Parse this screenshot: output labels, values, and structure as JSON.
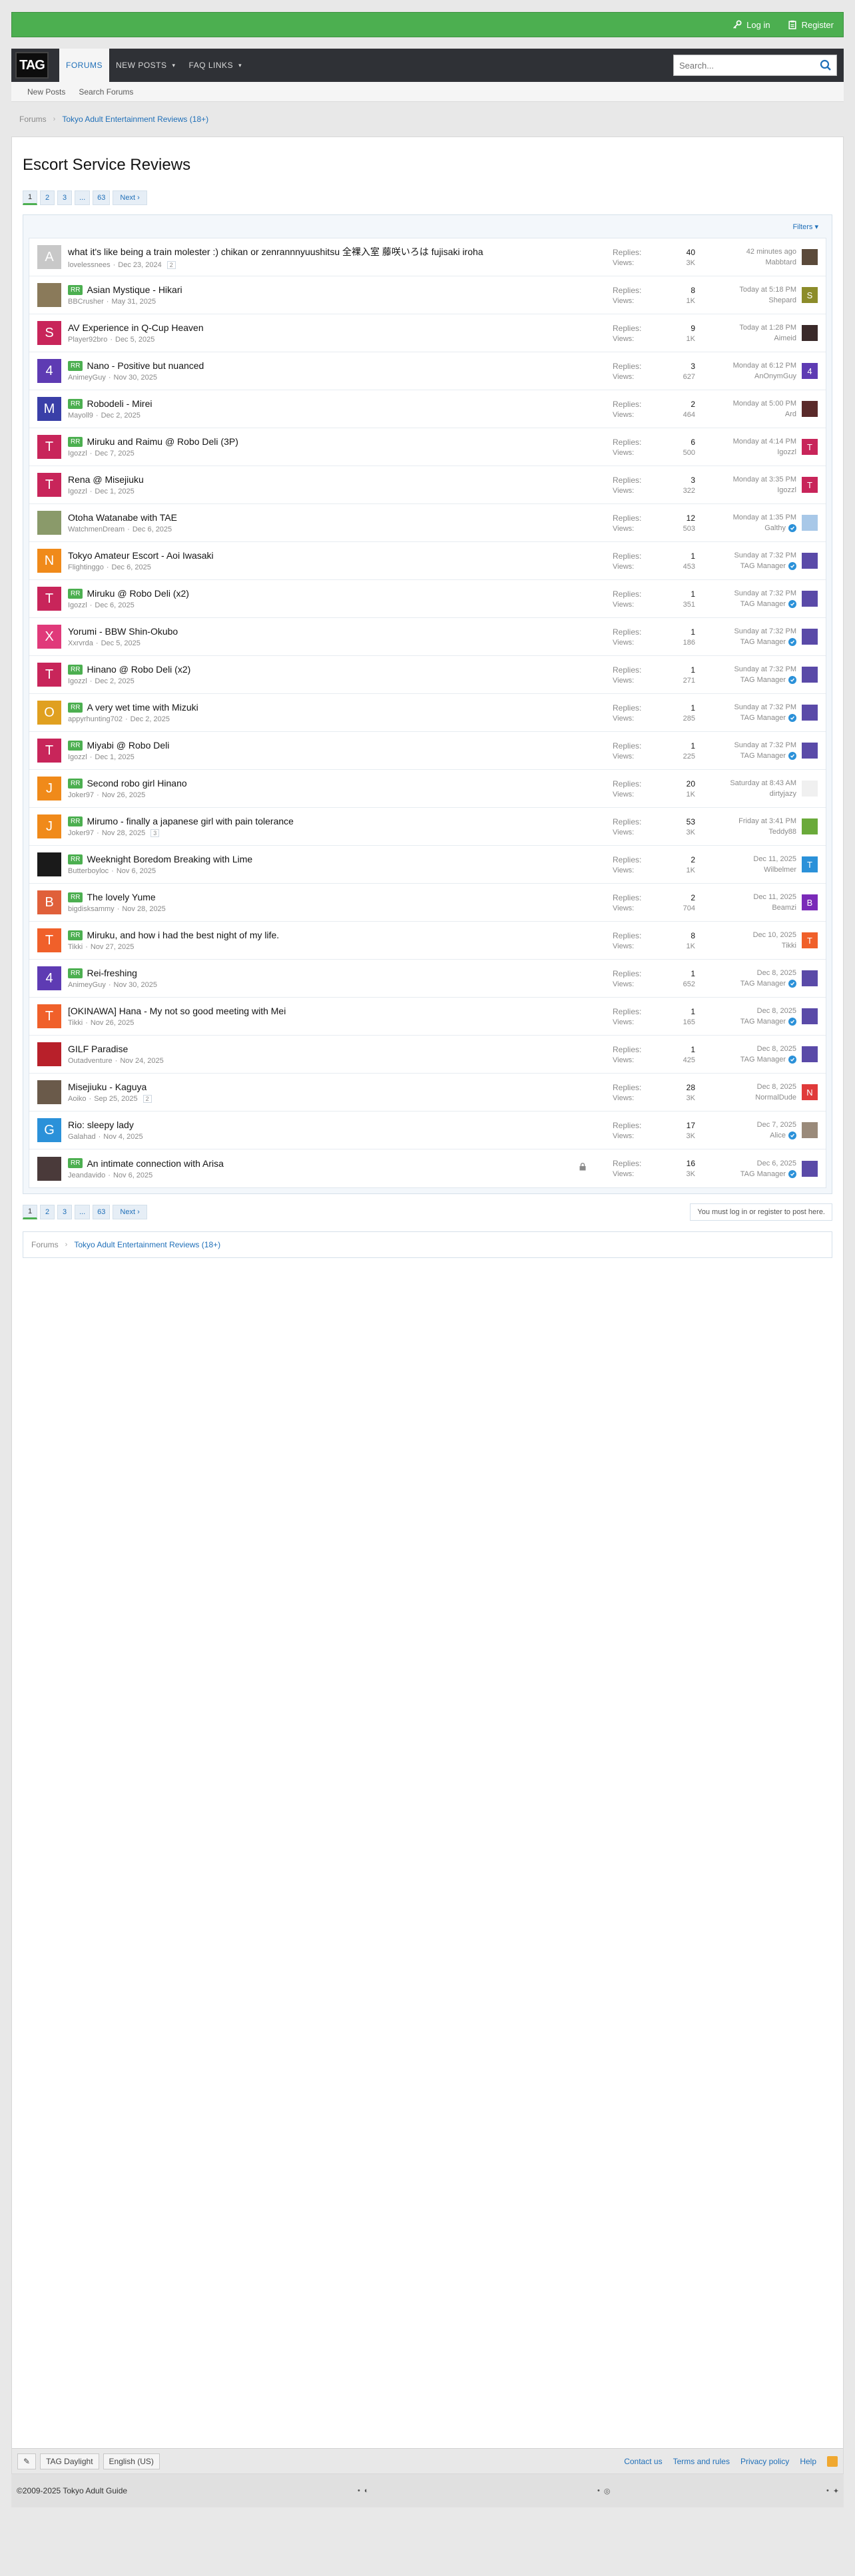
{
  "topbar": {
    "login": "Log in",
    "register": "Register"
  },
  "nav": {
    "logo": "TAG",
    "tabs": [
      {
        "label": "FORUMS",
        "active": true,
        "dropdown": false
      },
      {
        "label": "NEW POSTS",
        "active": false,
        "dropdown": true
      },
      {
        "label": "FAQ LINKS",
        "active": false,
        "dropdown": true
      }
    ],
    "search_placeholder": "Search..."
  },
  "subnav": [
    "New Posts",
    "Search Forums"
  ],
  "breadcrumb": {
    "root": "Forums",
    "current": "Tokyo Adult Entertainment Reviews (18+)"
  },
  "page": {
    "title": "Escort Service Reviews"
  },
  "pager": {
    "pages": [
      "1",
      "2",
      "3",
      "...",
      "63"
    ],
    "next": "Next"
  },
  "filters": "Filters",
  "labels": {
    "replies": "Replies:",
    "views": "Views:"
  },
  "threads": [
    {
      "title": "what it's like being a train molester :) chikan or zenrannnyuushitsu 全裸入室 藤咲いろは fujisaki iroha",
      "prefix": "",
      "author": "lovelessnees",
      "date": "Dec 23, 2024",
      "pages": "2",
      "replies": "40",
      "views": "3K",
      "last_time": "42 minutes ago",
      "last_user": "Mabbtard",
      "av": "A",
      "av_color": "#c8c8c8",
      "sav": "",
      "sav_color": "#5b4a3a",
      "verified": false,
      "locked": false
    },
    {
      "title": "Asian Mystique - Hikari",
      "prefix": "RR",
      "author": "BBCrusher",
      "date": "May 31, 2025",
      "pages": "",
      "replies": "8",
      "views": "1K",
      "last_time": "Today at 5:18 PM",
      "last_user": "Shepard",
      "av": "",
      "av_color": "#8a7a5a",
      "sav": "S",
      "sav_color": "#8c8c2a",
      "verified": false,
      "locked": false
    },
    {
      "title": "AV Experience in Q-Cup Heaven",
      "prefix": "",
      "author": "Player92bro",
      "date": "Dec 5, 2025",
      "pages": "",
      "replies": "9",
      "views": "1K",
      "last_time": "Today at 1:28 PM",
      "last_user": "Aimeid",
      "av": "S",
      "av_color": "#c8255a",
      "sav": "",
      "sav_color": "#3a2a2a",
      "verified": false,
      "locked": false
    },
    {
      "title": "Nano - Positive but nuanced",
      "prefix": "RR",
      "author": "AnimeyGuy",
      "date": "Nov 30, 2025",
      "pages": "",
      "replies": "3",
      "views": "627",
      "last_time": "Monday at 6:12 PM",
      "last_user": "AnOnymGuy",
      "av": "4",
      "av_color": "#5e3bb3",
      "sav": "4",
      "sav_color": "#5e3bb3",
      "verified": false,
      "locked": false
    },
    {
      "title": "Robodeli - Mirei",
      "prefix": "RR",
      "author": "Mayoll9",
      "date": "Dec 2, 2025",
      "pages": "",
      "replies": "2",
      "views": "464",
      "last_time": "Monday at 5:00 PM",
      "last_user": "Ard",
      "av": "M",
      "av_color": "#3a3fa8",
      "sav": "",
      "sav_color": "#5a2a2a",
      "verified": false,
      "locked": false
    },
    {
      "title": "Miruku and Raimu @ Robo Deli (3P)",
      "prefix": "RR",
      "author": "Igozzl",
      "date": "Dec 7, 2025",
      "pages": "",
      "replies": "6",
      "views": "500",
      "last_time": "Monday at 4:14 PM",
      "last_user": "Igozzl",
      "av": "T",
      "av_color": "#c8255a",
      "sav": "T",
      "sav_color": "#c8255a",
      "verified": false,
      "locked": false
    },
    {
      "title": "Rena @ Misejiuku",
      "prefix": "",
      "author": "Igozzl",
      "date": "Dec 1, 2025",
      "pages": "",
      "replies": "3",
      "views": "322",
      "last_time": "Monday at 3:35 PM",
      "last_user": "Igozzl",
      "av": "T",
      "av_color": "#c8255a",
      "sav": "T",
      "sav_color": "#c8255a",
      "verified": false,
      "locked": false
    },
    {
      "title": "Otoha Watanabe with TAE",
      "prefix": "",
      "author": "WatchmenDream",
      "date": "Dec 6, 2025",
      "pages": "",
      "replies": "12",
      "views": "503",
      "last_time": "Monday at 1:35 PM",
      "last_user": "Galthy",
      "av": "",
      "av_color": "#8a9a6a",
      "sav": "",
      "sav_color": "#a8c8e8",
      "verified": true,
      "locked": false
    },
    {
      "title": "Tokyo Amateur Escort - Aoi Iwasaki",
      "prefix": "",
      "author": "Flightinggo",
      "date": "Dec 6, 2025",
      "pages": "",
      "replies": "1",
      "views": "453",
      "last_time": "Sunday at 7:32 PM",
      "last_user": "TAG Manager",
      "av": "N",
      "av_color": "#f08a1a",
      "sav": "",
      "sav_color": "#5a4aa8",
      "verified": true,
      "locked": false
    },
    {
      "title": "Miruku @ Robo Deli (x2)",
      "prefix": "RR",
      "author": "Igozzl",
      "date": "Dec 6, 2025",
      "pages": "",
      "replies": "1",
      "views": "351",
      "last_time": "Sunday at 7:32 PM",
      "last_user": "TAG Manager",
      "av": "T",
      "av_color": "#c8255a",
      "sav": "",
      "sav_color": "#5a4aa8",
      "verified": true,
      "locked": false
    },
    {
      "title": "Yorumi - BBW Shin-Okubo",
      "prefix": "",
      "author": "Xxrvrda",
      "date": "Dec 5, 2025",
      "pages": "",
      "replies": "1",
      "views": "186",
      "last_time": "Sunday at 7:32 PM",
      "last_user": "TAG Manager",
      "av": "X",
      "av_color": "#e03a7a",
      "sav": "",
      "sav_color": "#5a4aa8",
      "verified": true,
      "locked": false
    },
    {
      "title": "Hinano @ Robo Deli (x2)",
      "prefix": "RR",
      "author": "Igozzl",
      "date": "Dec 2, 2025",
      "pages": "",
      "replies": "1",
      "views": "271",
      "last_time": "Sunday at 7:32 PM",
      "last_user": "TAG Manager",
      "av": "T",
      "av_color": "#c8255a",
      "sav": "",
      "sav_color": "#5a4aa8",
      "verified": true,
      "locked": false
    },
    {
      "title": "A very wet time with Mizuki",
      "prefix": "RR",
      "author": "appyrhunting702",
      "date": "Dec 2, 2025",
      "pages": "",
      "replies": "1",
      "views": "285",
      "last_time": "Sunday at 7:32 PM",
      "last_user": "TAG Manager",
      "av": "O",
      "av_color": "#e0a020",
      "sav": "",
      "sav_color": "#5a4aa8",
      "verified": true,
      "locked": false
    },
    {
      "title": "Miyabi @ Robo Deli",
      "prefix": "RR",
      "author": "Igozzl",
      "date": "Dec 1, 2025",
      "pages": "",
      "replies": "1",
      "views": "225",
      "last_time": "Sunday at 7:32 PM",
      "last_user": "TAG Manager",
      "av": "T",
      "av_color": "#c8255a",
      "sav": "",
      "sav_color": "#5a4aa8",
      "verified": true,
      "locked": false
    },
    {
      "title": "Second robo girl Hinano",
      "prefix": "RR",
      "author": "Joker97",
      "date": "Nov 26, 2025",
      "pages": "",
      "replies": "20",
      "views": "1K",
      "last_time": "Saturday at 8:43 AM",
      "last_user": "dirtyjazy",
      "av": "J",
      "av_color": "#f08a1a",
      "sav": "",
      "sav_color": "#f0f0f0",
      "verified": false,
      "locked": false
    },
    {
      "title": "Mirumo - finally a japanese girl with pain tolerance",
      "prefix": "RR",
      "author": "Joker97",
      "date": "Nov 28, 2025",
      "pages": "3",
      "replies": "53",
      "views": "3K",
      "last_time": "Friday at 3:41 PM",
      "last_user": "Teddy88",
      "av": "J",
      "av_color": "#f08a1a",
      "sav": "",
      "sav_color": "#6aaa3a",
      "verified": false,
      "locked": false
    },
    {
      "title": "Weeknight Boredom Breaking with Lime",
      "prefix": "RR",
      "author": "Butterboyloc",
      "date": "Nov 6, 2025",
      "pages": "",
      "replies": "2",
      "views": "1K",
      "last_time": "Dec 11, 2025",
      "last_user": "Wilbelmer",
      "av": "",
      "av_color": "#1a1a1a",
      "sav": "T",
      "sav_color": "#2b91d9",
      "verified": false,
      "locked": false
    },
    {
      "title": "The lovely Yume",
      "prefix": "RR",
      "author": "bigdisksammy",
      "date": "Nov 28, 2025",
      "pages": "",
      "replies": "2",
      "views": "704",
      "last_time": "Dec 11, 2025",
      "last_user": "Beamzi",
      "av": "B",
      "av_color": "#e0603a",
      "sav": "B",
      "sav_color": "#7a2ab8",
      "verified": false,
      "locked": false
    },
    {
      "title": "Miruku, and how i had the best night of my life.",
      "prefix": "RR",
      "author": "Tikki",
      "date": "Nov 27, 2025",
      "pages": "",
      "replies": "8",
      "views": "1K",
      "last_time": "Dec 10, 2025",
      "last_user": "Tikki",
      "av": "T",
      "av_color": "#f0602a",
      "sav": "T",
      "sav_color": "#f0602a",
      "verified": false,
      "locked": false
    },
    {
      "title": "Rei-freshing",
      "prefix": "RR",
      "author": "AnimeyGuy",
      "date": "Nov 30, 2025",
      "pages": "",
      "replies": "1",
      "views": "652",
      "last_time": "Dec 8, 2025",
      "last_user": "TAG Manager",
      "av": "4",
      "av_color": "#5e3bb3",
      "sav": "",
      "sav_color": "#5a4aa8",
      "verified": true,
      "locked": false
    },
    {
      "title": "[OKINAWA] Hana - My not so good meeting with Mei",
      "prefix": "",
      "author": "Tikki",
      "date": "Nov 26, 2025",
      "pages": "",
      "replies": "1",
      "views": "165",
      "last_time": "Dec 8, 2025",
      "last_user": "TAG Manager",
      "av": "T",
      "av_color": "#f0602a",
      "sav": "",
      "sav_color": "#5a4aa8",
      "verified": true,
      "locked": false
    },
    {
      "title": "GILF Paradise",
      "prefix": "",
      "author": "Outadventure",
      "date": "Nov 24, 2025",
      "pages": "",
      "replies": "1",
      "views": "425",
      "last_time": "Dec 8, 2025",
      "last_user": "TAG Manager",
      "av": "",
      "av_color": "#b8202a",
      "sav": "",
      "sav_color": "#5a4aa8",
      "verified": true,
      "locked": false
    },
    {
      "title": "Misejiuku - Kaguya",
      "prefix": "",
      "author": "Aoiko",
      "date": "Sep 25, 2025",
      "pages": "2",
      "replies": "28",
      "views": "3K",
      "last_time": "Dec 8, 2025",
      "last_user": "NormalDude",
      "av": "",
      "av_color": "#6a5a4a",
      "sav": "N",
      "sav_color": "#e03a3a",
      "verified": false,
      "locked": false
    },
    {
      "title": "Rio: sleepy lady",
      "prefix": "",
      "author": "Galahad",
      "date": "Nov 4, 2025",
      "pages": "",
      "replies": "17",
      "views": "3K",
      "last_time": "Dec 7, 2025",
      "last_user": "Alice",
      "av": "G",
      "av_color": "#2b91d9",
      "sav": "",
      "sav_color": "#9a8a7a",
      "verified": true,
      "locked": false
    },
    {
      "title": "An intimate connection with Arisa",
      "prefix": "RR",
      "author": "Jeandavido",
      "date": "Nov 6, 2025",
      "pages": "",
      "replies": "16",
      "views": "3K",
      "last_time": "Dec 6, 2025",
      "last_user": "TAG Manager",
      "av": "",
      "av_color": "#4a3a3a",
      "sav": "",
      "sav_color": "#5a4aa8",
      "verified": true,
      "locked": true
    }
  ],
  "must_login": "You must log in or register to post here.",
  "footer": {
    "style_btn": "TAG Daylight",
    "lang_btn": "English (US)",
    "links": [
      "Contact us",
      "Terms and rules",
      "Privacy policy",
      "Help"
    ],
    "copyright": "©2009-2025 Tokyo Adult Guide"
  },
  "colors": {
    "green": "#4caf50",
    "link": "#1f6fb8",
    "nav": "#2f3136"
  }
}
